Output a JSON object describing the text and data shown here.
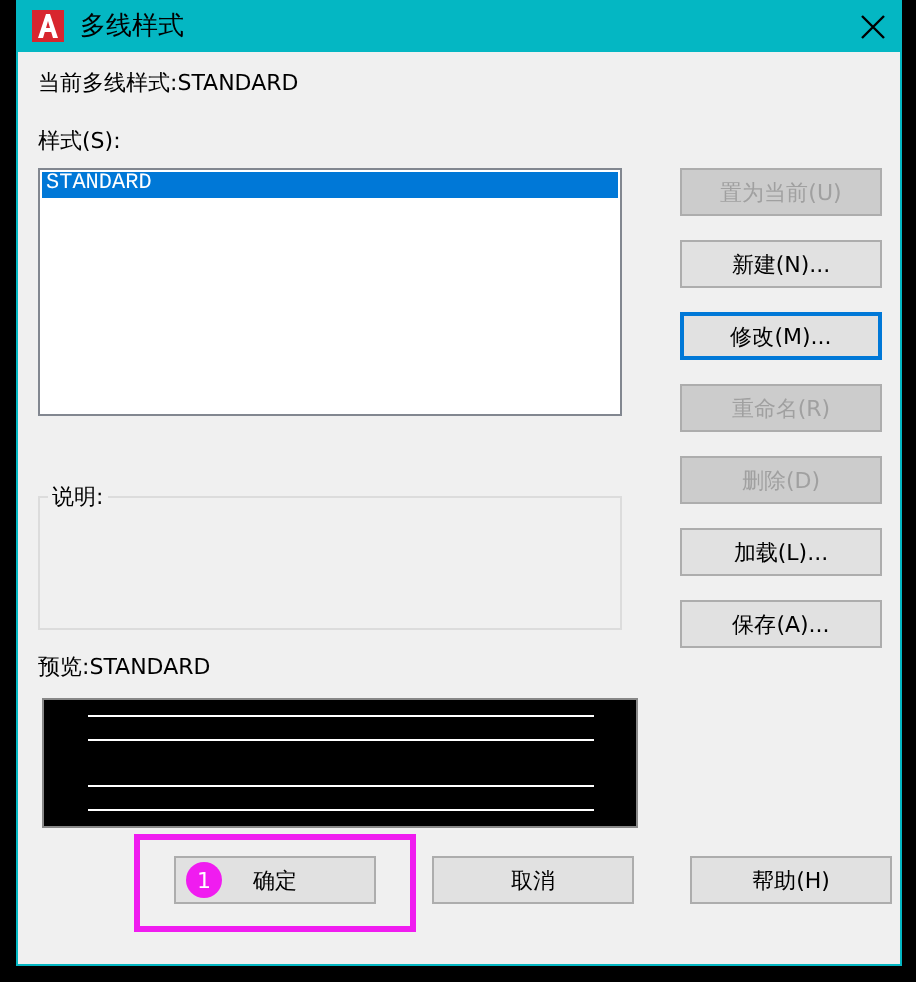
{
  "window": {
    "title": "多线样式"
  },
  "current_style": "当前多线样式:STANDARD",
  "styles_label": "样式(S):",
  "styles": [
    {
      "label": "STANDARD",
      "selected": true
    }
  ],
  "side_buttons": [
    {
      "label": "置为当前(U)",
      "disabled": true,
      "focused": false
    },
    {
      "label": "新建(N)...",
      "disabled": false,
      "focused": false
    },
    {
      "label": "修改(M)...",
      "disabled": false,
      "focused": true
    },
    {
      "label": "重命名(R)",
      "disabled": true,
      "focused": false
    },
    {
      "label": "删除(D)",
      "disabled": true,
      "focused": false
    },
    {
      "label": "加载(L)...",
      "disabled": false,
      "focused": false
    },
    {
      "label": "保存(A)...",
      "disabled": false,
      "focused": false
    }
  ],
  "description_label": "说明:",
  "preview_label": "预览:STANDARD",
  "bottom_buttons": [
    {
      "label": "确定",
      "highlighted": true,
      "step": "1"
    },
    {
      "label": "取消",
      "highlighted": false
    },
    {
      "label": "帮助(H)",
      "highlighted": false
    }
  ]
}
